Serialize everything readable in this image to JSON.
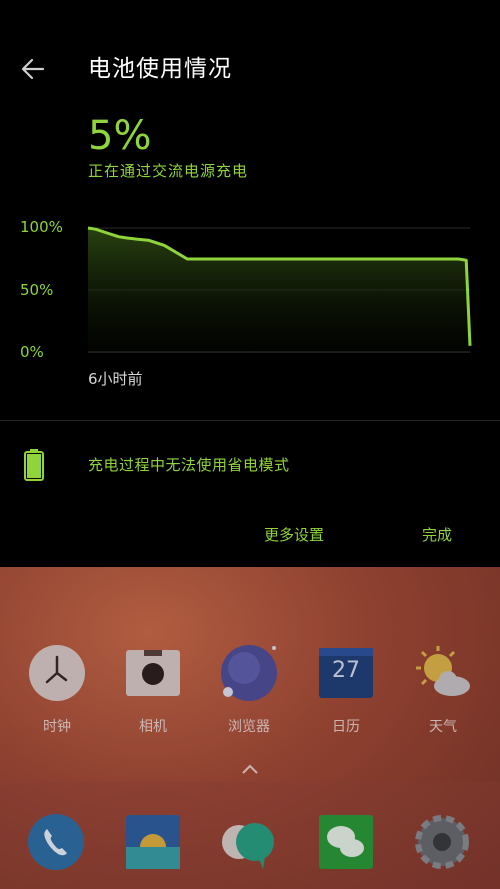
{
  "header": {
    "title": "电池使用情况"
  },
  "battery": {
    "level_text": "5%",
    "status_text": "正在通过交流电源充电"
  },
  "chart_data": {
    "type": "line",
    "title": "",
    "y_ticks": [
      "100%",
      "50%",
      "0%"
    ],
    "x_start_label": "6小时前",
    "ylim": [
      0,
      100
    ],
    "x": [
      0,
      0.02,
      0.05,
      0.08,
      0.1,
      0.13,
      0.16,
      0.2,
      0.26,
      0.3,
      0.97,
      0.99,
      1.0
    ],
    "values": [
      100,
      99,
      96,
      93,
      92,
      91,
      90,
      86,
      75,
      75,
      75,
      74,
      5
    ],
    "line_color": "#8fd43a"
  },
  "saver": {
    "text": "充电过程中无法使用省电模式"
  },
  "buttons": {
    "more_settings": "更多设置",
    "done": "完成"
  },
  "home": {
    "apps": [
      {
        "label": "时钟",
        "icon": "clock-icon"
      },
      {
        "label": "相机",
        "icon": "camera-icon"
      },
      {
        "label": "浏览器",
        "icon": "browser-icon"
      },
      {
        "label": "日历",
        "icon": "calendar-icon",
        "day": "27"
      },
      {
        "label": "天气",
        "icon": "weather-icon"
      }
    ],
    "dock": [
      "phone-icon",
      "gallery-icon",
      "messages-icon",
      "wechat-icon",
      "settings-icon"
    ]
  },
  "colors": {
    "accent": "#8fd43a",
    "background": "#000000"
  }
}
